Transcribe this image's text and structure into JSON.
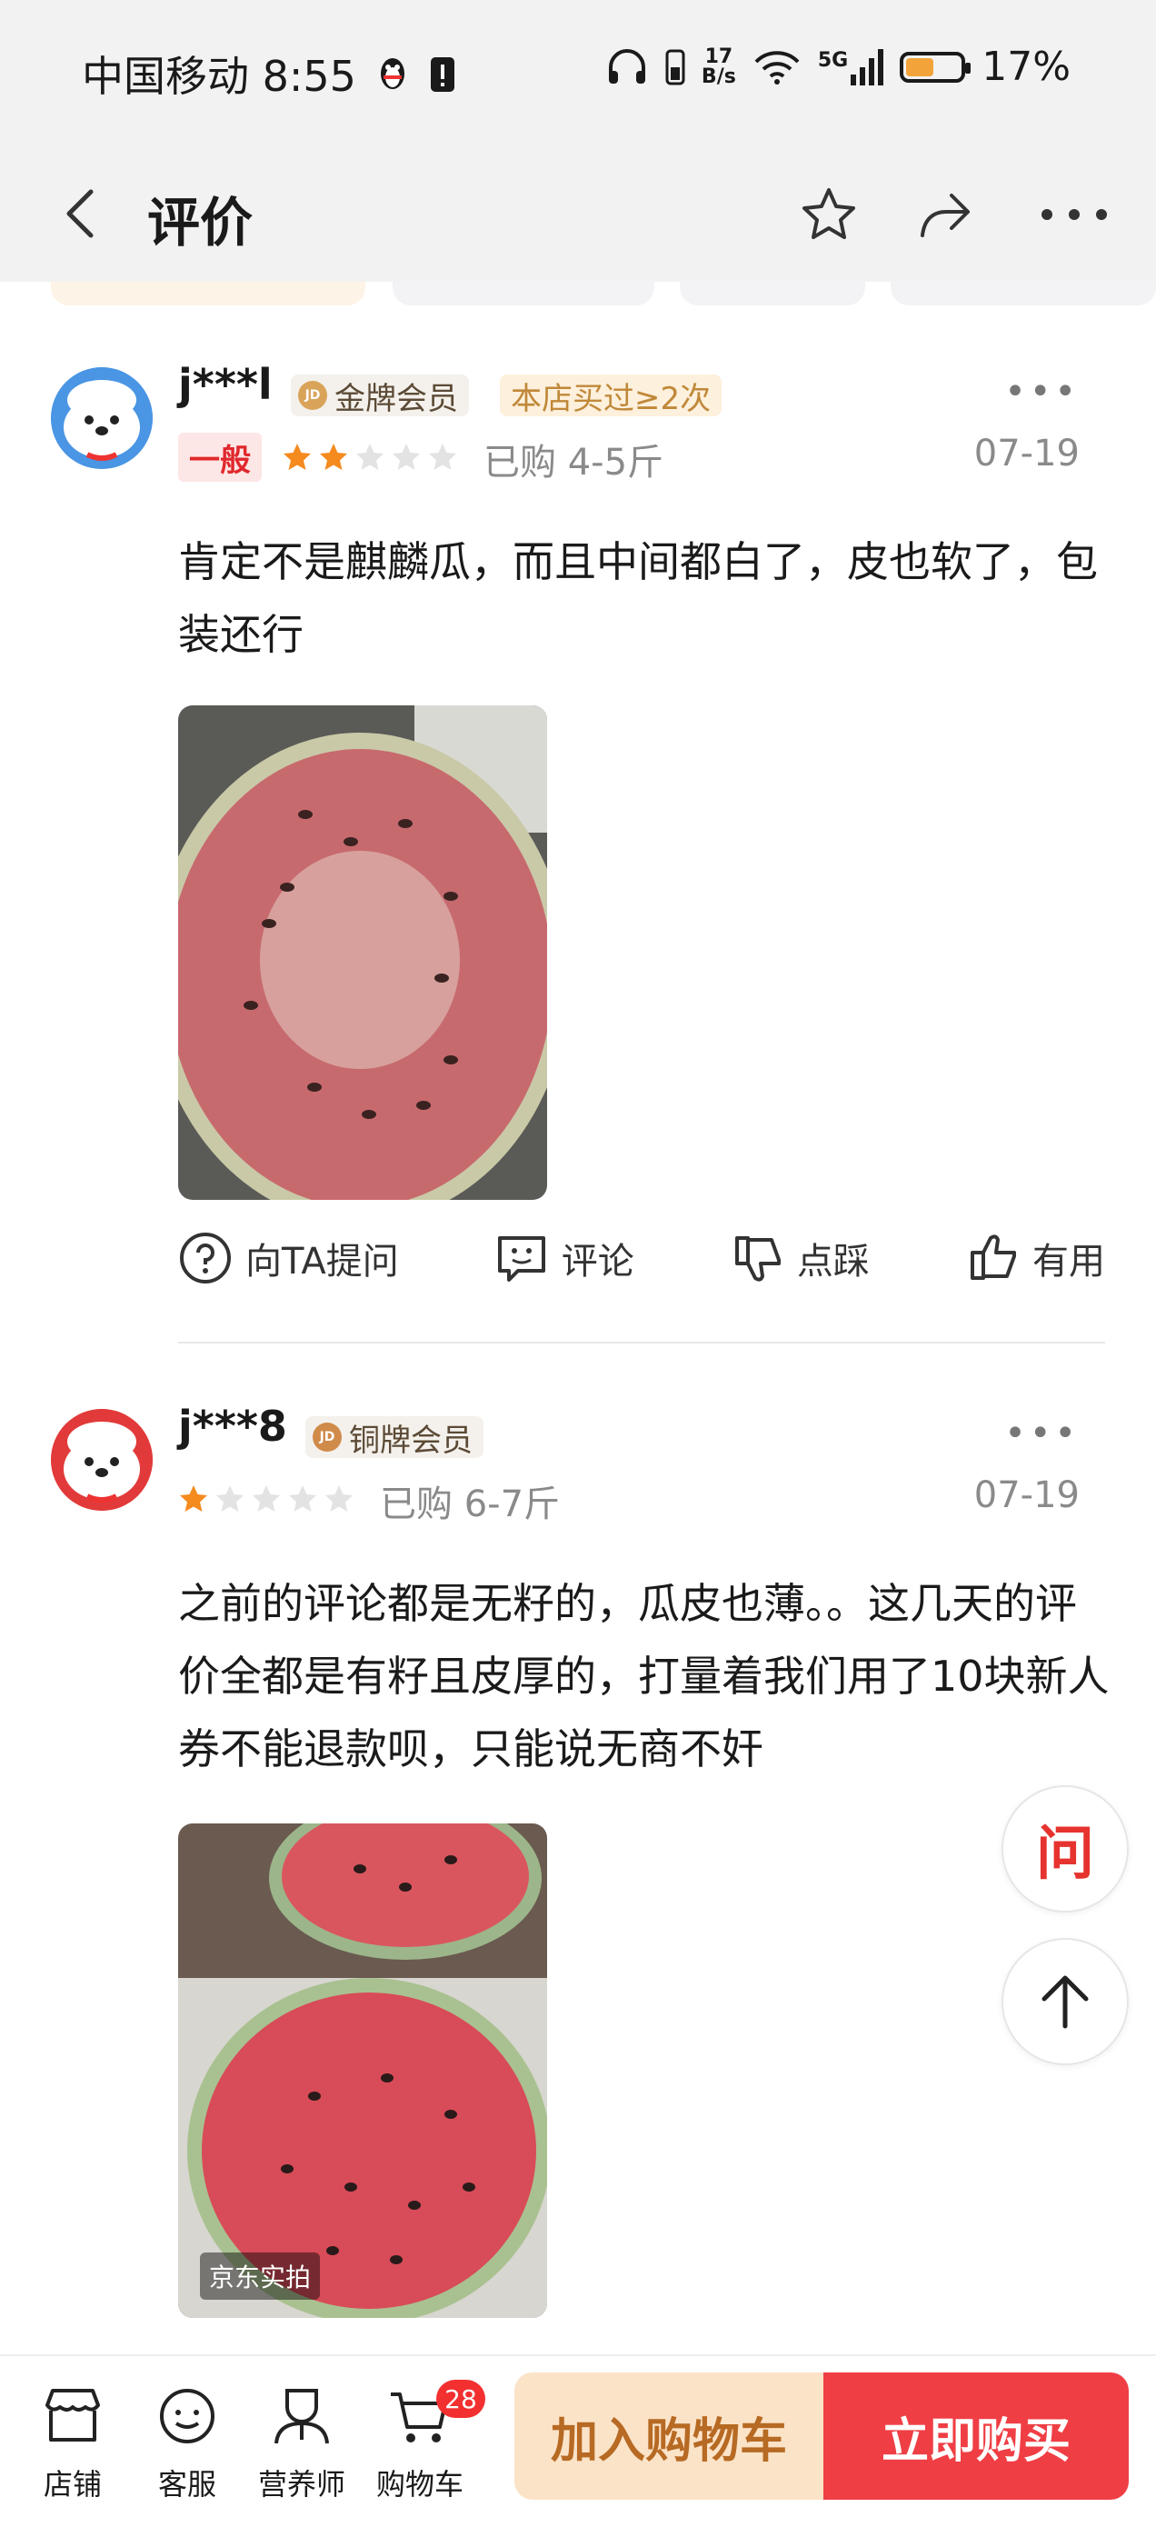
{
  "status_bar": {
    "carrier_time": "中国移动 8:55",
    "net_speed_value": "17",
    "net_speed_unit": "B/s",
    "network": "5G",
    "battery_percent": "17%",
    "battery_level": 0.17
  },
  "nav": {
    "title": "评价",
    "icons": [
      "back-icon",
      "star-icon",
      "share-icon",
      "more-icon"
    ]
  },
  "reviews": [
    {
      "username": "j***l",
      "member_level": "金牌会员",
      "repeat_purchase": "本店买过≥2次",
      "rating_label": "一般",
      "stars": 2,
      "purchase": "已购 4-5斤",
      "date": "07-19",
      "text": "肯定不是麒麟瓜，而且中间都白了，皮也软了，包装还行",
      "actions": [
        "向TA提问",
        "评论",
        "点踩",
        "有用"
      ]
    },
    {
      "username": "j***8",
      "member_level": "铜牌会员",
      "stars": 1,
      "purchase": "已购 6-7斤",
      "date": "07-19",
      "text": "之前的评论都是无籽的，瓜皮也薄。。这几天的评价全都是有籽且皮厚的，打量着我们用了10块新人券不能退款呗，只能说无商不奸",
      "photo_tag": "京东实拍"
    }
  ],
  "floating": {
    "ask_label": "问"
  },
  "bottom_bar": {
    "shop": "店铺",
    "service": "客服",
    "nutritionist": "营养师",
    "cart": "购物车",
    "cart_count": "28",
    "add_to_cart": "加入购物车",
    "buy_now": "立即购买"
  },
  "colors": {
    "accent_red": "#ef3e44",
    "star_orange": "#f58a1f",
    "add_cart_bg": "#fbe3c8"
  }
}
